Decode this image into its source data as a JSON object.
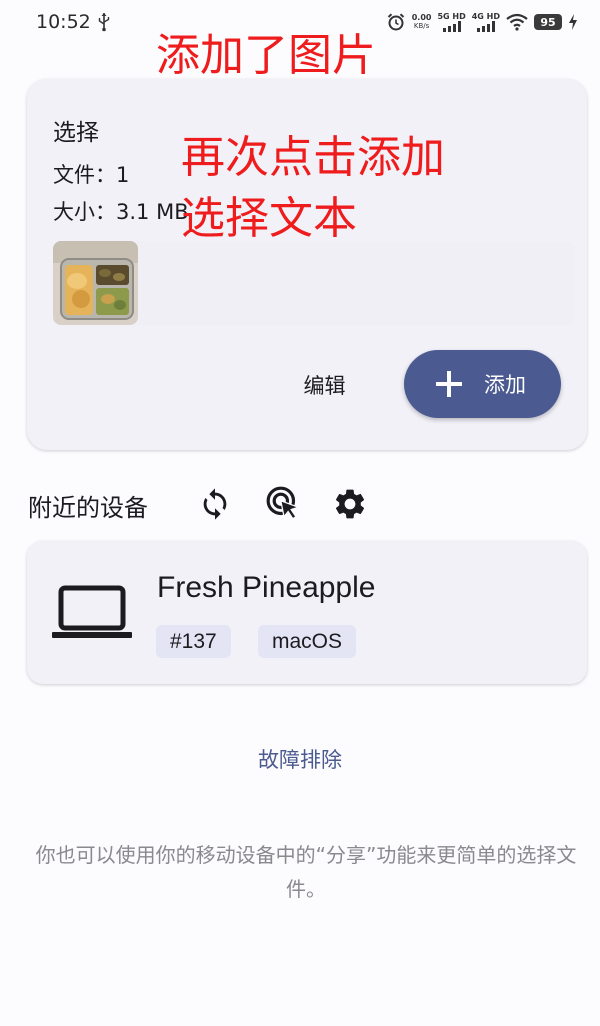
{
  "status_bar": {
    "time": "10:52",
    "speed_value": "0.00",
    "speed_unit": "KB/s",
    "net1": "5G HD",
    "net2": "4G HD",
    "battery": "95"
  },
  "annotations": {
    "top": "添加了图片",
    "middle_line1": "再次点击添加",
    "middle_line2": "选择文本"
  },
  "selection": {
    "title": "选择",
    "files": "文件：1",
    "size": "大小：3.1 MB",
    "edit_label": "编辑",
    "add_label": "添加"
  },
  "nearby": {
    "title": "附近的设备",
    "icons": [
      "refresh-icon",
      "target-cursor-icon",
      "gear-icon"
    ]
  },
  "device": {
    "name": "Fresh Pineapple",
    "tags": [
      "#137",
      "macOS"
    ],
    "icon": "laptop-icon"
  },
  "troubleshoot_label": "故障排除",
  "hint_text": "你也可以使用你的移动设备中的“分享”功能来更简单的选择文件。",
  "colors": {
    "accent": "#4b5b91",
    "card_bg": "#f2f1f8",
    "annotation": "#ee1c1c",
    "chip_bg": "#e3e5f5"
  }
}
